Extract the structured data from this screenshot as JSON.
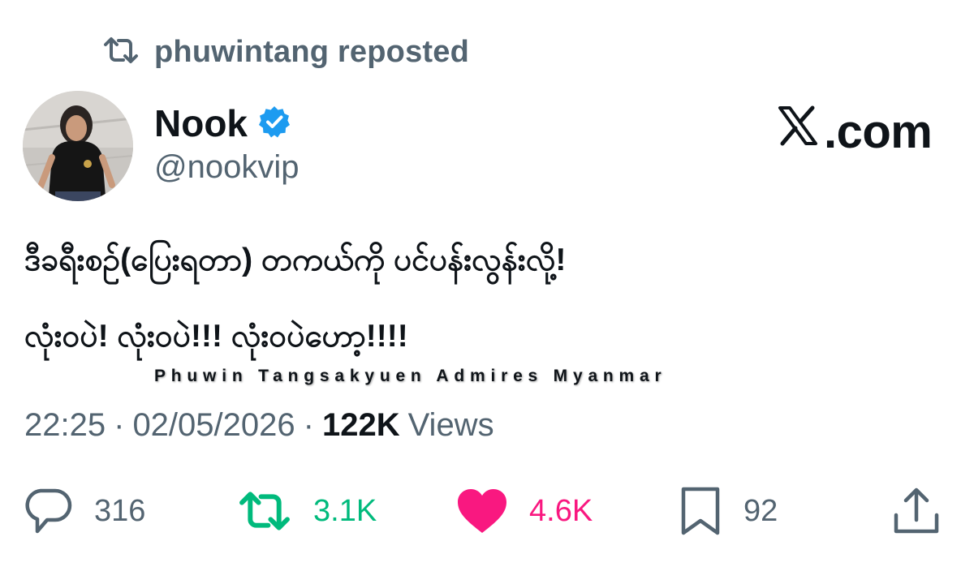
{
  "repost": {
    "icon": "retweet-icon",
    "text": "phuwintang reposted"
  },
  "author": {
    "name": "Nook",
    "verified": true,
    "verified_color": "#1d9bf0",
    "handle": "@nookvip"
  },
  "watermark": {
    "text": ".com",
    "logo": "x-logo-icon"
  },
  "tweet": {
    "line1": "ဒီခရီးစဉ်(ပြေးရတာ) တကယ်ကို ပင်ပန်းလွန်းလို့!",
    "line2": "လုံးဝပဲ! လုံးဝပဲ!!! လုံးဝပဲဟော့!!!!"
  },
  "caption": "Phuwin Tangsakyuen Admires Myanmar",
  "meta": {
    "time": "22:25",
    "sep1": "·",
    "date": "02/05/2026",
    "sep2": "·",
    "views_count": "122K",
    "views_label": "Views"
  },
  "actions": {
    "reply": {
      "icon": "reply-icon",
      "count": "316"
    },
    "retweet": {
      "icon": "retweet-icon",
      "count": "3.1K",
      "color": "#00ba7c"
    },
    "like": {
      "icon": "heart-icon",
      "count": "4.6K",
      "color": "#f91880"
    },
    "bookmark": {
      "icon": "bookmark-icon",
      "count": "92"
    },
    "share": {
      "icon": "share-icon"
    }
  },
  "colors": {
    "text_primary": "#0f1419",
    "text_secondary": "#536471"
  }
}
